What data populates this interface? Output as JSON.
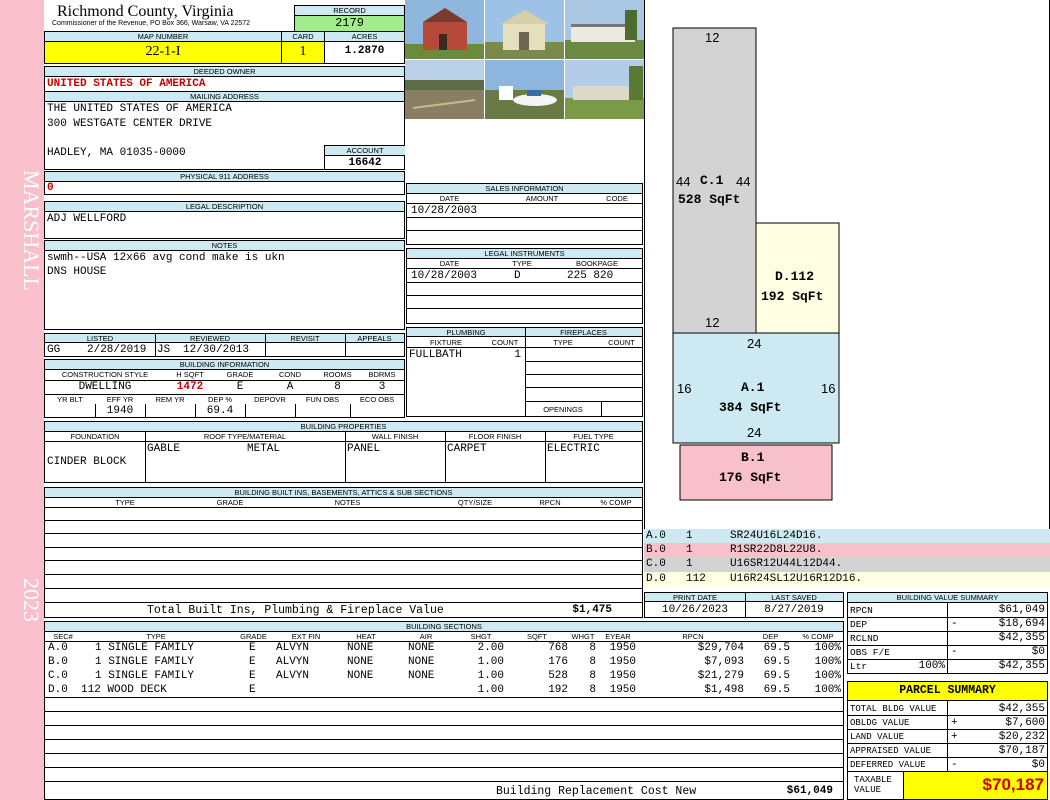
{
  "sidebar": {
    "district": "MARSHALL",
    "year": "2023"
  },
  "header": {
    "county": "Richmond County, Virginia",
    "commissioner": "Commissioner of the Revenue, PO Box 366, Warsaw, VA 22572",
    "record_label": "RECORD",
    "record": "2179",
    "map_label": "MAP NUMBER",
    "map_number": "22-1-I",
    "card_label": "CARD",
    "card": "1",
    "acres_label": "ACRES",
    "acres": "1.2870"
  },
  "owner": {
    "label": "DEEDED OWNER",
    "name": "UNITED STATES OF AMERICA",
    "mail_label": "MAILING ADDRESS",
    "line1": "THE UNITED STATES OF AMERICA",
    "line2": "300 WESTGATE CENTER DRIVE",
    "line3": "HADLEY, MA 01035-0000",
    "account_label": "ACCOUNT",
    "account": "16642"
  },
  "address911": {
    "label": "PHYSICAL 911 ADDRESS",
    "value": "0"
  },
  "legal": {
    "label": "LEGAL DESCRIPTION",
    "value": "ADJ WELLFORD"
  },
  "notes": {
    "label": "NOTES",
    "line1": "swmh--USA 12x66 avg cond make is ukn",
    "line2": "DNS HOUSE"
  },
  "listing": {
    "listed_label": "LISTED",
    "reviewed_label": "REVIEWED",
    "revisit_label": "REVISIT",
    "appeals_label": "APPEALS",
    "listed_by": "GG",
    "listed_date": "2/28/2019",
    "reviewed_by": "JS",
    "reviewed_date": "12/30/2013"
  },
  "building_info": {
    "label": "BUILDING INFORMATION",
    "h_style": "CONSTRUCTION STYLE",
    "h_sqft": "H SQFT",
    "h_grade": "GRADE",
    "h_cond": "COND",
    "h_rooms": "ROOMS",
    "h_bdrms": "BDRMS",
    "style": "DWELLING",
    "sqft": "1472",
    "grade": "E",
    "cond": "A",
    "rooms": "8",
    "bdrms": "3",
    "h_yrblt": "YR BLT",
    "h_effyr": "EFF YR",
    "h_remyr": "REM YR",
    "h_dep": "DEP %",
    "h_depovr": "DEPOVR",
    "h_funobs": "FUN OBS",
    "h_ecoobs": "ECO OBS",
    "effyr": "1940",
    "dep": "69.4"
  },
  "sales": {
    "label": "SALES INFORMATION",
    "h_date": "DATE",
    "h_amount": "AMOUNT",
    "h_code": "CODE",
    "date": "10/28/2003"
  },
  "instruments": {
    "label": "LEGAL INSTRUMENTS",
    "h_date": "DATE",
    "h_type": "TYPE",
    "h_book": "BOOKPAGE",
    "date": "10/28/2003",
    "type": "D",
    "book": "225 820"
  },
  "plumbing": {
    "label": "PLUMBING",
    "h_fixture": "FIXTURE",
    "h_count": "COUNT",
    "fixture": "FULLBATH",
    "count": "1"
  },
  "fireplaces": {
    "label": "FIREPLACES",
    "h_type": "TYPE",
    "h_count": "COUNT",
    "openings": "OPENINGS"
  },
  "properties": {
    "label": "BUILDING PROPERTIES",
    "h_foundation": "FOUNDATION",
    "h_roof": "ROOF TYPE/MATERIAL",
    "h_wall": "WALL FINISH",
    "h_floor": "FLOOR FINISH",
    "h_fuel": "FUEL TYPE",
    "foundation": "CINDER BLOCK",
    "roof_type": "GABLE",
    "roof_mat": "METAL",
    "wall": "PANEL",
    "floor": "CARPET",
    "fuel": "ELECTRIC"
  },
  "builtins": {
    "label": "BUILDING BUILT INS, BASEMENTS, ATTICS & SUB SECTIONS",
    "h_type": "TYPE",
    "h_grade": "GRADE",
    "h_notes": "NOTES",
    "h_qty": "QTY/SIZE",
    "h_rpcn": "RPCN",
    "h_comp": "% COMP",
    "total_label": "Total Built Ins, Plumbing & Fireplace Value",
    "total": "$1,475"
  },
  "sections": {
    "label": "BUILDING SECTIONS",
    "headers": [
      "SEC#",
      "TYPE",
      "GRADE",
      "EXT FIN",
      "HEAT",
      "AIR",
      "SHGT",
      "SQFT",
      "WHGT",
      "EYEAR",
      "RPCN",
      "DEP",
      "% COMP"
    ],
    "rows": [
      {
        "sec": "A.0",
        "type": "1 SINGLE FAMILY",
        "grade": "E",
        "ext": "ALVYN",
        "heat": "NONE",
        "air": "NONE",
        "shgt": "2.00",
        "sqft": "768",
        "whgt": "8",
        "eyear": "1950",
        "rpcn": "$29,704",
        "dep": "69.5",
        "comp": "100%"
      },
      {
        "sec": "B.0",
        "type": "1 SINGLE FAMILY",
        "grade": "E",
        "ext": "ALVYN",
        "heat": "NONE",
        "air": "NONE",
        "shgt": "1.00",
        "sqft": "176",
        "whgt": "8",
        "eyear": "1950",
        "rpcn": "$7,093",
        "dep": "69.5",
        "comp": "100%"
      },
      {
        "sec": "C.0",
        "type": "1 SINGLE FAMILY",
        "grade": "E",
        "ext": "ALVYN",
        "heat": "NONE",
        "air": "NONE",
        "shgt": "1.00",
        "sqft": "528",
        "whgt": "8",
        "eyear": "1950",
        "rpcn": "$21,279",
        "dep": "69.5",
        "comp": "100%"
      },
      {
        "sec": "D.0",
        "type": "112 WOOD DECK",
        "grade": "E",
        "ext": "",
        "heat": "",
        "air": "",
        "shgt": "1.00",
        "sqft": "192",
        "whgt": "8",
        "eyear": "1950",
        "rpcn": "$1,498",
        "dep": "69.5",
        "comp": "100%"
      }
    ],
    "replacement_label": "Building Replacement Cost New",
    "replacement": "$61,049"
  },
  "sketch": {
    "c_label": "C.1",
    "c_area": "528 SqFt",
    "c_top": "12",
    "c_left": "44",
    "c_right": "44",
    "c_bottom": "12",
    "d_label": "D.112",
    "d_area": "192 SqFt",
    "a_label": "A.1",
    "a_area": "384 SqFt",
    "a_top": "24",
    "a_left": "16",
    "a_right": "16",
    "a_bottom": "24",
    "b_label": "B.1",
    "b_area": "176 SqFt",
    "legend": [
      {
        "sec": "A.0",
        "n": "1",
        "code": "SR24U16L24D16.",
        "color": "#cde9f1"
      },
      {
        "sec": "B.0",
        "n": "1",
        "code": "R1SR22D8L22U8.",
        "color": "#f8c0cb"
      },
      {
        "sec": "C.0",
        "n": "1",
        "code": "U16SR12U44L12D44.",
        "color": "#d3d3d3"
      },
      {
        "sec": "D.0",
        "n": "112",
        "code": "U16R24SL12U16R12D16.",
        "color": "#fffde2"
      }
    ]
  },
  "print": {
    "print_label": "PRINT DATE",
    "saved_label": "LAST SAVED",
    "print_date": "10/26/2023",
    "saved_date": "8/27/2019"
  },
  "value_summary": {
    "label": "BUILDING VALUE SUMMARY",
    "rpcn_label": "RPCN",
    "rpcn": "$61,049",
    "dep_label": "DEP",
    "dep_sign": "-",
    "dep": "$18,694",
    "rcnld_label": "RCLND",
    "rcnld": "$42,355",
    "obs_label": "OBS F/E",
    "obs_sign": "-",
    "obs": "$0",
    "ltr_label": "Ltr",
    "ltr_pct": "100%",
    "ltr": "$42,355"
  },
  "parcel": {
    "label": "PARCEL SUMMARY",
    "total_bldg_label": "TOTAL BLDG VALUE",
    "total_bldg": "$42,355",
    "obldg_label": "OBLDG VALUE",
    "obldg_sign": "+",
    "obldg": "$7,600",
    "land_label": "LAND VALUE",
    "land_sign": "+",
    "land": "$20,232",
    "appraised_label": "APPRAISED VALUE",
    "appraised": "$70,187",
    "deferred_label": "DEFERRED VALUE",
    "deferred_sign": "-",
    "deferred": "$0",
    "taxable_label1": "TAXABLE",
    "taxable_label2": "VALUE",
    "taxable": "$70,187"
  },
  "colors": {
    "header_blue": "#cde9f1",
    "yellow": "#ffff00",
    "green": "#a3ec8b",
    "pink": "#f9c0cb",
    "red": "#cc0000"
  }
}
